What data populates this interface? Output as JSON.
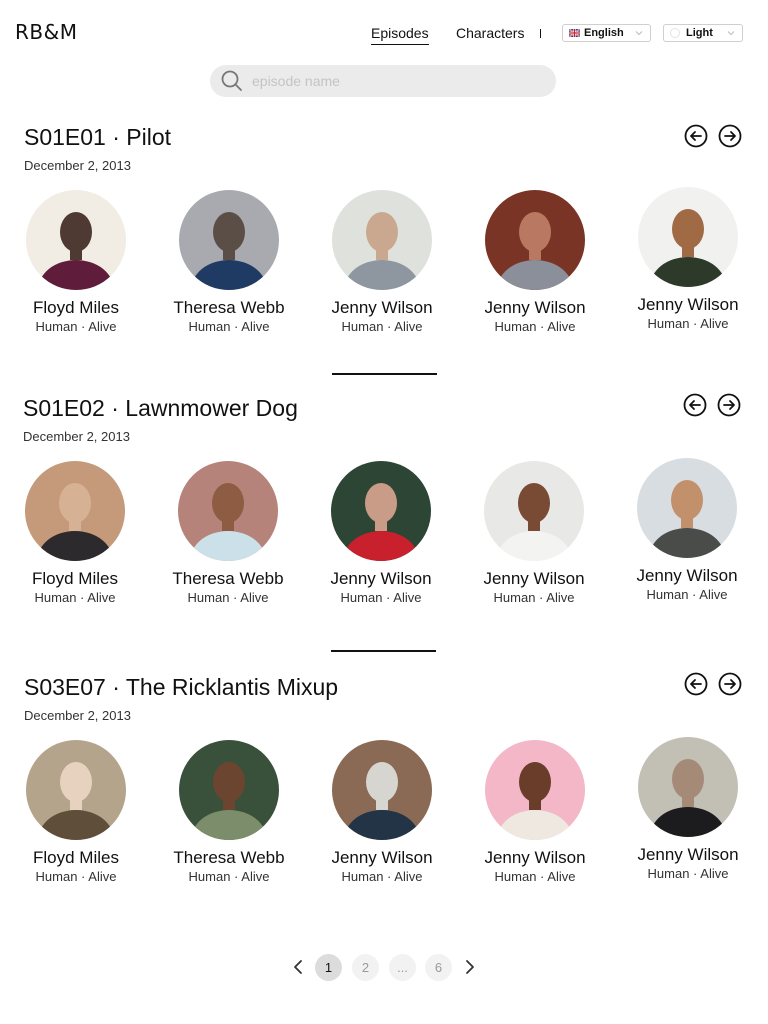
{
  "header": {
    "logo": "RB&M",
    "nav": [
      {
        "label": "Episodes",
        "active": true
      },
      {
        "label": "Characters",
        "active": false
      }
    ],
    "language": {
      "selected": "English",
      "icon": "uk-flag-icon"
    },
    "theme": {
      "selected": "Light",
      "icon": "theme-circle-icon"
    }
  },
  "search": {
    "placeholder": "episode name",
    "value": ""
  },
  "episodes": [
    {
      "title": "S01E01 · Pilot",
      "date": "December 2, 2013",
      "characters": [
        {
          "name": "Floyd Miles",
          "meta": "Human · Alive",
          "colors": [
            "#f1ece4",
            "#4e3a32",
            "#5f1d3b"
          ]
        },
        {
          "name": "Theresa Webb",
          "meta": "Human · Alive",
          "colors": [
            "#a9aab0",
            "#5b4e46",
            "#1f3b63"
          ]
        },
        {
          "name": "Jenny Wilson",
          "meta": "Human · Alive",
          "colors": [
            "#dfe2dc",
            "#caa890",
            "#8e96a0"
          ]
        },
        {
          "name": "Jenny Wilson",
          "meta": "Human · Alive",
          "colors": [
            "#7a3425",
            "#b97862",
            "#8a8f99"
          ]
        },
        {
          "name": "Jenny Wilson",
          "meta": "Human · Alive",
          "colors": [
            "#f1f1ef",
            "#a06a44",
            "#2d3a2a"
          ]
        }
      ]
    },
    {
      "title": "S01E02 · Lawnmower Dog",
      "date": "December 2, 2013",
      "characters": [
        {
          "name": "Floyd Miles",
          "meta": "Human · Alive",
          "colors": [
            "#c49a7a",
            "#d7b193",
            "#2c2a2c"
          ]
        },
        {
          "name": "Theresa Webb",
          "meta": "Human · Alive",
          "colors": [
            "#b6837a",
            "#8d5c42",
            "#cbe0e8"
          ]
        },
        {
          "name": "Jenny Wilson",
          "meta": "Human · Alive",
          "colors": [
            "#2d4535",
            "#c89c86",
            "#c8202c"
          ]
        },
        {
          "name": "Jenny Wilson",
          "meta": "Human · Alive",
          "colors": [
            "#e8e8e6",
            "#7a4b34",
            "#f3f3f1"
          ]
        },
        {
          "name": "Jenny Wilson",
          "meta": "Human · Alive",
          "colors": [
            "#d8dde2",
            "#c2906a",
            "#4a4c4a"
          ]
        }
      ]
    },
    {
      "title": "S03E07 · The Ricklantis Mixup",
      "date": "December 2, 2013",
      "characters": [
        {
          "name": "Floyd Miles",
          "meta": "Human · Alive",
          "colors": [
            "#b5a48c",
            "#e6d2be",
            "#5e4e3a"
          ]
        },
        {
          "name": "Theresa Webb",
          "meta": "Human · Alive",
          "colors": [
            "#39503a",
            "#6b4530",
            "#7b8d6a"
          ]
        },
        {
          "name": "Jenny Wilson",
          "meta": "Human · Alive",
          "colors": [
            "#8a6a54",
            "#d7d5d0",
            "#223446"
          ]
        },
        {
          "name": "Jenny Wilson",
          "meta": "Human · Alive",
          "colors": [
            "#f3b7c7",
            "#6a3d2a",
            "#efe8e1"
          ]
        },
        {
          "name": "Jenny Wilson",
          "meta": "Human · Alive",
          "colors": [
            "#c2bfb5",
            "#a58a78",
            "#1c1c1e"
          ]
        }
      ]
    }
  ],
  "pagination": {
    "pages": [
      "1",
      "2",
      "...",
      "6"
    ],
    "current": "1"
  }
}
